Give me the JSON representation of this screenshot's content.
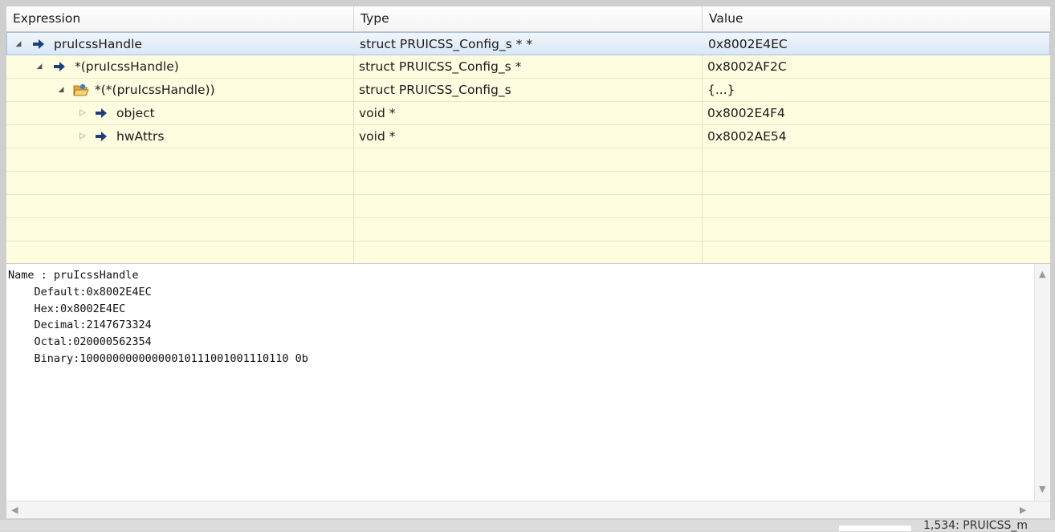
{
  "header": {
    "col_expression": "Expression",
    "col_type": "Type",
    "col_value": "Value"
  },
  "rows": [
    {
      "expression": "pruIcssHandle",
      "type": "struct PRUICSS_Config_s * *",
      "value": "0x8002E4EC",
      "expanded": true,
      "selected": true,
      "icon": "pointer-arrow-icon"
    },
    {
      "expression": "*(pruIcssHandle)",
      "type": "struct PRUICSS_Config_s *",
      "value": "0x8002AF2C",
      "expanded": true,
      "icon": "pointer-arrow-icon"
    },
    {
      "expression": "*(*(pruIcssHandle))",
      "type": "struct PRUICSS_Config_s",
      "value": "{...}",
      "expanded": true,
      "icon": "open-folder-struct-icon"
    },
    {
      "expression": "object",
      "type": "void *",
      "value": "0x8002E4F4",
      "expanded": false,
      "icon": "pointer-arrow-icon"
    },
    {
      "expression": "hwAttrs",
      "type": "void *",
      "value": "0x8002AE54",
      "expanded": false,
      "icon": "pointer-arrow-icon"
    }
  ],
  "details": {
    "name_line": "Name : pruIcssHandle",
    "default_line": "    Default:0x8002E4EC",
    "hex_line": "    Hex:0x8002E4EC",
    "decimal_line": "    Decimal:2147673324",
    "octal_line": "    Octal:020000562354",
    "binary_line": "    Binary:10000000000000010111001001110110 0b"
  },
  "status": {
    "text": "1,534: PRUICSS_m"
  },
  "colors": {
    "row_bg": "#fffde0",
    "selected_bg": "#d9e7f6",
    "pointer_icon": "#1f3d7a"
  }
}
